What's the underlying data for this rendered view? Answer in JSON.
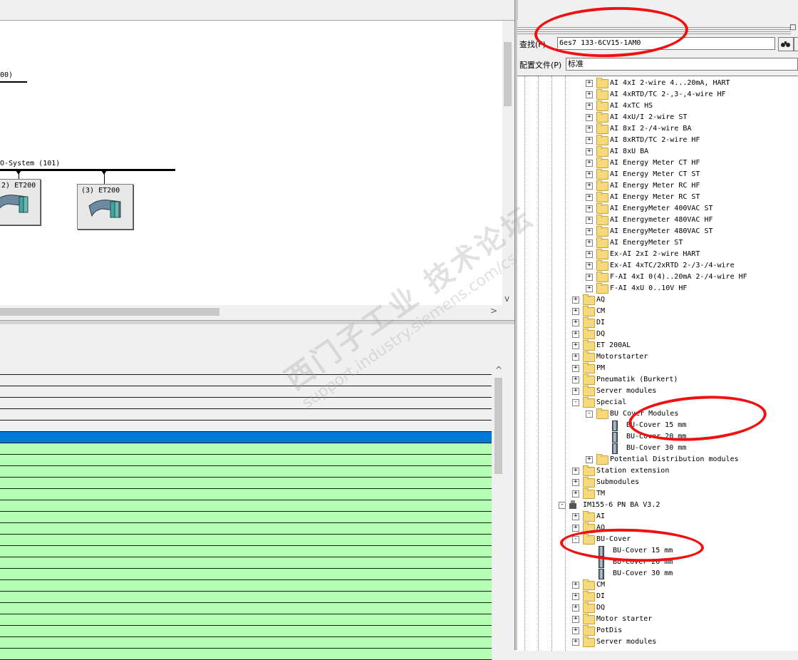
{
  "network": {
    "label_partial_top": "00)",
    "bus_label": "O-System (101)",
    "station2_label": "(2) ET200",
    "station3_label": "(3) ET200"
  },
  "catalog": {
    "find_label": "查找(F)",
    "find_value": "6es7 133-6CV15-1AM0",
    "find_btn_icon": "binoculars-arrows-icon",
    "profile_label": "配置文件(P)",
    "profile_value": "标准",
    "tree": [
      {
        "label": "AI 4xI 2-wire 4...20mA, HART",
        "icon": "folder"
      },
      {
        "label": "AI 4xRTD/TC 2-,3-,4-wire HF",
        "icon": "folder"
      },
      {
        "label": "AI 4xTC HS",
        "icon": "folder"
      },
      {
        "label": "AI 4xU/I 2-wire ST",
        "icon": "folder"
      },
      {
        "label": "AI 8xI 2-/4-wire BA",
        "icon": "folder"
      },
      {
        "label": "AI 8xRTD/TC 2-wire HF",
        "icon": "folder"
      },
      {
        "label": "AI 8xU BA",
        "icon": "folder"
      },
      {
        "label": "AI Energy Meter CT HF",
        "icon": "folder"
      },
      {
        "label": "AI Energy Meter CT ST",
        "icon": "folder"
      },
      {
        "label": "AI Energy Meter RC HF",
        "icon": "folder"
      },
      {
        "label": "AI Energy Meter RC ST",
        "icon": "folder"
      },
      {
        "label": "AI EnergyMeter 400VAC ST",
        "icon": "folder"
      },
      {
        "label": "AI Energymeter 480VAC HF",
        "icon": "folder"
      },
      {
        "label": "AI EnergyMeter 480VAC ST",
        "icon": "folder"
      },
      {
        "label": "AI EnergyMeter ST",
        "icon": "folder"
      },
      {
        "label": "Ex-AI 2xI 2-wire HART",
        "icon": "folder"
      },
      {
        "label": "Ex-AI 4xTC/2xRTD 2-/3-/4-wire",
        "icon": "folder"
      },
      {
        "label": "F-AI 4xI 0(4)..20mA 2-/4-wire HF",
        "icon": "folder"
      },
      {
        "label": "F-AI 4xU 0..10V HF",
        "icon": "folder"
      },
      {
        "label": "AQ",
        "icon": "folder"
      },
      {
        "label": "CM",
        "icon": "folder"
      },
      {
        "label": "DI",
        "icon": "folder"
      },
      {
        "label": "DQ",
        "icon": "folder"
      },
      {
        "label": "ET 200AL",
        "icon": "folder"
      },
      {
        "label": "Motorstarter",
        "icon": "folder"
      },
      {
        "label": "PM",
        "icon": "folder"
      },
      {
        "label": "Pneumatik (Burkert)",
        "icon": "folder"
      },
      {
        "label": "Server modules",
        "icon": "folder"
      },
      {
        "label": "Special",
        "icon": "folder"
      },
      {
        "label": "BU Cover Modules",
        "icon": "folder"
      },
      {
        "label": "BU-Cover 15 mm",
        "icon": "module"
      },
      {
        "label": "BU-Cover 20 mm",
        "icon": "module"
      },
      {
        "label": "BU-Cover 30 mm",
        "icon": "module"
      },
      {
        "label": "Potential Distribution modules",
        "icon": "folder"
      },
      {
        "label": "Station extension",
        "icon": "folder"
      },
      {
        "label": "Submodules",
        "icon": "folder"
      },
      {
        "label": "TM",
        "icon": "folder"
      },
      {
        "label": "IM155-6 PN BA V3.2",
        "icon": "im"
      },
      {
        "label": "AI",
        "icon": "folder"
      },
      {
        "label": "AQ",
        "icon": "folder"
      },
      {
        "label": "BU-Cover",
        "icon": "folder"
      },
      {
        "label": "BU-Cover 15 mm",
        "icon": "module"
      },
      {
        "label": "BU-Cover 20 mm",
        "icon": "module"
      },
      {
        "label": "BU-Cover 30 mm",
        "icon": "module"
      },
      {
        "label": "CM",
        "icon": "folder"
      },
      {
        "label": "DI",
        "icon": "folder"
      },
      {
        "label": "DQ",
        "icon": "folder"
      },
      {
        "label": "Motor starter",
        "icon": "folder"
      },
      {
        "label": "PotDis",
        "icon": "folder"
      },
      {
        "label": "Server modules",
        "icon": "folder"
      }
    ]
  },
  "table": {
    "selected_color": "#0078d7",
    "row_color": "#b3ffb3",
    "header_row_color": "#f0f0f0"
  },
  "watermark": {
    "line1": "西门子工业 技术论坛",
    "line2": "support.industry.siemens.com/cs"
  },
  "scroll": {
    "left_arrow": "<",
    "right_arrow": ">",
    "up_arrow": "^",
    "down_arrow": "v"
  }
}
